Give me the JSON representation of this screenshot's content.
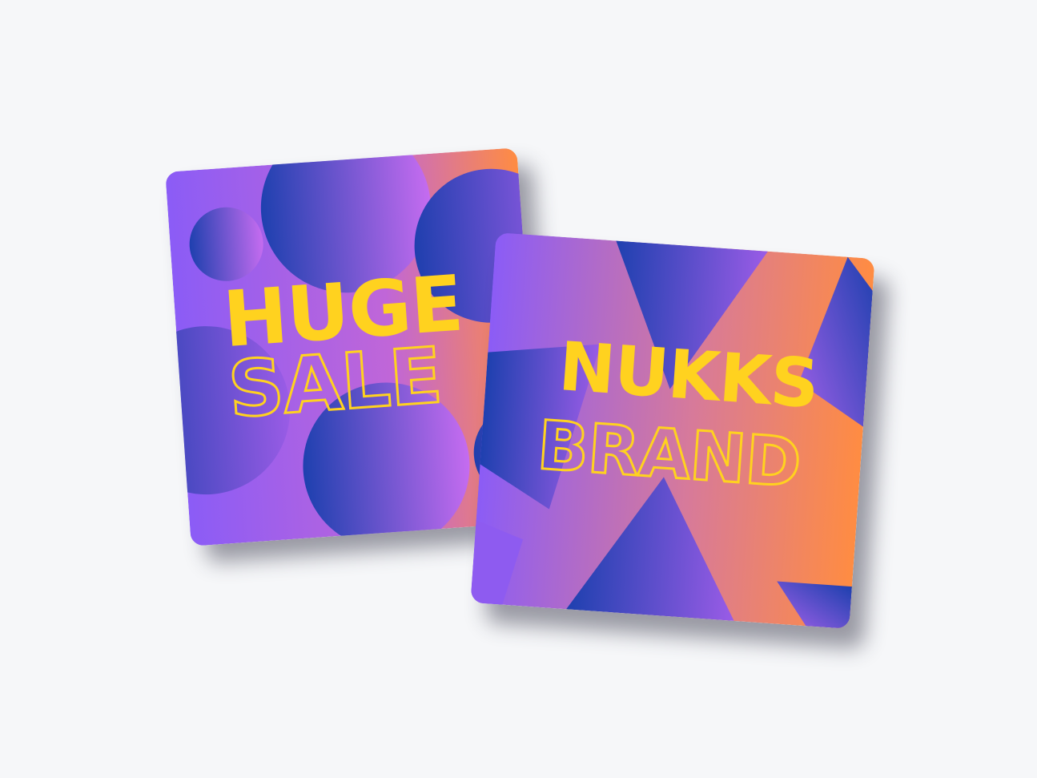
{
  "cards": [
    {
      "line1": "HUGE",
      "line2": "SALE",
      "motif": "circles"
    },
    {
      "line1": "NUKKS",
      "line2": "BRAND",
      "motif": "triangles"
    }
  ],
  "colors": {
    "background": "#f6f7f9",
    "purple": "#8b5cf6",
    "orange": "#ff8c42",
    "blue": "#1e40af",
    "text_yellow": "#ffd21f"
  }
}
